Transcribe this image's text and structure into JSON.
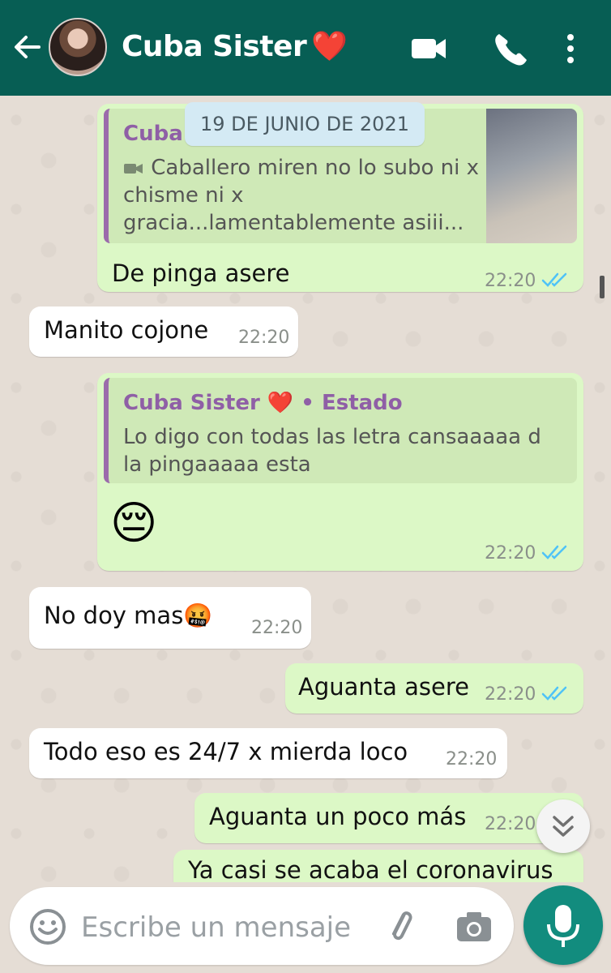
{
  "header": {
    "contact_name": "Cuba Sister",
    "contact_emoji": "❤️",
    "back_icon": "arrow-left",
    "video_icon": "video-camera",
    "call_icon": "phone",
    "menu_icon": "more-vertical"
  },
  "date_chip": "19 DE JUNIO DE 2021",
  "messages": [
    {
      "direction": "outgoing",
      "quote": {
        "author": "Cuba S",
        "media_icon": "video-icon",
        "text_lines": [
          "Caballero miren no lo subo ni x",
          "chisme ni x",
          "gracia...lamentablemente asiii..."
        ]
      },
      "text": "De pinga asere",
      "time": "22:20",
      "status": "read"
    },
    {
      "direction": "incoming",
      "text": "Manito cojone",
      "time": "22:20"
    },
    {
      "direction": "outgoing",
      "quote": {
        "author": "Cuba Sister",
        "author_emoji": "❤️",
        "suffix": " • Estado",
        "text_lines": [
          "Lo digo con todas las letra cansaaaaa d",
          "la pingaaaaa esta"
        ]
      },
      "text": "😔",
      "time": "22:20",
      "status": "read"
    },
    {
      "direction": "incoming",
      "text": "No doy mas🤬",
      "time": "22:20"
    },
    {
      "direction": "outgoing",
      "text": "Aguanta asere",
      "time": "22:20",
      "status": "read"
    },
    {
      "direction": "incoming",
      "text": "Todo eso es 24/7 x mierda loco",
      "time": "22:20"
    },
    {
      "direction": "outgoing",
      "text": "Aguanta un poco más",
      "time": "22:20"
    },
    {
      "direction": "outgoing",
      "text": "Ya casi se acaba el coronavirus"
    }
  ],
  "composer": {
    "placeholder": "Escribe un mensaje",
    "emoji_icon": "smiley",
    "attach_icon": "paperclip",
    "camera_icon": "camera",
    "mic_icon": "microphone"
  },
  "colors": {
    "header": "#075e54",
    "outgoing_bubble": "#dcf8c6",
    "incoming_bubble": "#ffffff",
    "read_ticks": "#4fc3f7",
    "quote_author": "#8f5fa6",
    "mic_button": "#128c7e"
  }
}
